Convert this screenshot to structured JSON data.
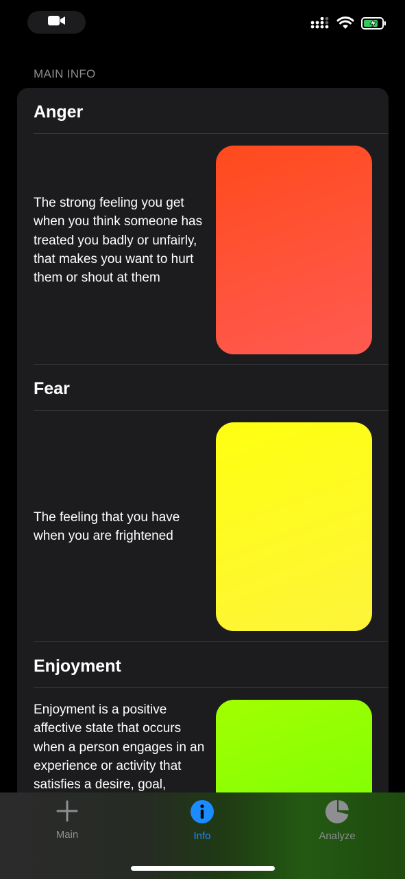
{
  "section_header": "MAIN INFO",
  "emotions": [
    {
      "title": "Anger",
      "description": "The strong feeling you get when you think someone has treated you badly or unfairly, that makes you want to hurt them or shout at them",
      "color_from": "#ff4a1c",
      "color_to": "#ff5a52"
    },
    {
      "title": "Fear",
      "description": "The feeling that you have when you are frightened",
      "color_from": "#ffff10",
      "color_to": "#fdf43a"
    },
    {
      "title": "Enjoyment",
      "description": "Enjoyment is a positive affective state that occurs when a person engages in an experience or activity that satisfies a desire, goal,",
      "color_from": "#a2ff00",
      "color_to": "#6cff0a"
    }
  ],
  "tabs": [
    {
      "label": "Main",
      "icon": "plus-icon",
      "active": false
    },
    {
      "label": "Info",
      "icon": "info-icon",
      "active": true
    },
    {
      "label": "Analyze",
      "icon": "pie-chart-icon",
      "active": false
    }
  ],
  "colors": {
    "accent": "#1a8cff",
    "inactive_tab": "#8e8e93",
    "card_bg": "#1c1c1e"
  }
}
